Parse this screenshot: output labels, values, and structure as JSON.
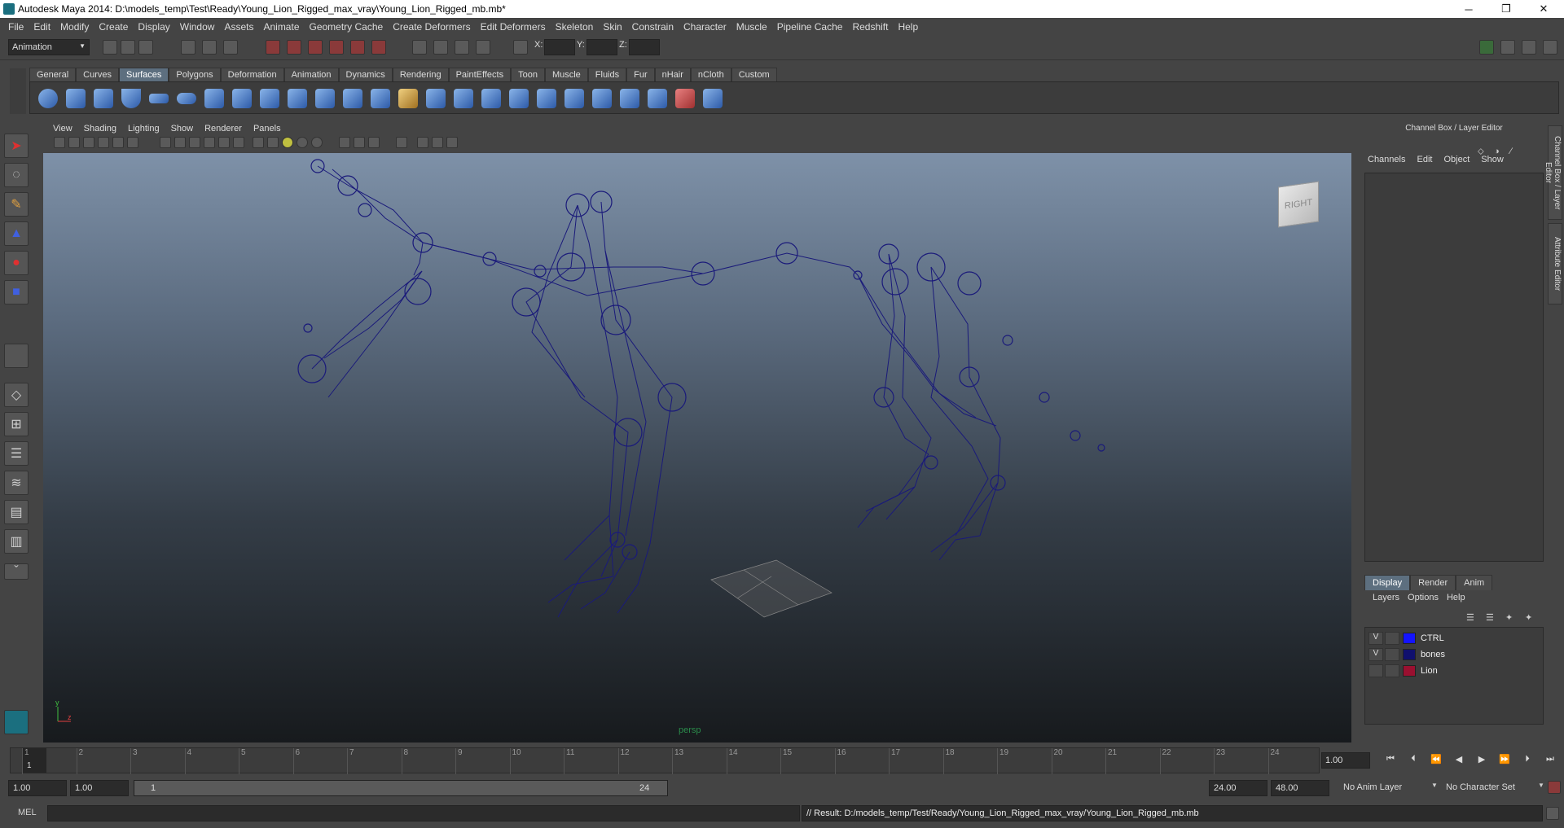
{
  "title": "Autodesk Maya 2014: D:\\models_temp\\Test\\Ready\\Young_Lion_Rigged_max_vray\\Young_Lion_Rigged_mb.mb*",
  "menus": [
    "File",
    "Edit",
    "Modify",
    "Create",
    "Display",
    "Window",
    "Assets",
    "Animate",
    "Geometry Cache",
    "Create Deformers",
    "Edit Deformers",
    "Skeleton",
    "Skin",
    "Constrain",
    "Character",
    "Muscle",
    "Pipeline Cache",
    "Redshift",
    "Help"
  ],
  "mode": "Animation",
  "xyz": {
    "x": "X:",
    "y": "Y:",
    "z": "Z:"
  },
  "shelf_tabs": [
    "General",
    "Curves",
    "Surfaces",
    "Polygons",
    "Deformation",
    "Animation",
    "Dynamics",
    "Rendering",
    "PaintEffects",
    "Toon",
    "Muscle",
    "Fluids",
    "Fur",
    "nHair",
    "nCloth",
    "Custom"
  ],
  "active_shelf": "Surfaces",
  "panel_menus": [
    "View",
    "Shading",
    "Lighting",
    "Show",
    "Renderer",
    "Panels"
  ],
  "viewcube_label": "RIGHT",
  "camera": "persp",
  "channel_box": {
    "title": "Channel Box / Layer Editor",
    "menus": [
      "Channels",
      "Edit",
      "Object",
      "Show"
    ]
  },
  "layer_tabs": [
    "Display",
    "Render",
    "Anim"
  ],
  "layer_menus": [
    "Layers",
    "Options",
    "Help"
  ],
  "layers": [
    {
      "vis": "V",
      "name": "CTRL",
      "color": "#1414ff"
    },
    {
      "vis": "V",
      "name": "bones",
      "color": "#10106e"
    },
    {
      "vis": "",
      "name": "Lion",
      "color": "#9a1030"
    }
  ],
  "side_tabs": [
    "Channel Box / Layer Editor",
    "Attribute Editor"
  ],
  "ticks": [
    "1",
    "2",
    "3",
    "4",
    "5",
    "6",
    "7",
    "8",
    "9",
    "10",
    "11",
    "12",
    "13",
    "14",
    "15",
    "16",
    "17",
    "18",
    "19",
    "20",
    "21",
    "22",
    "23",
    "24"
  ],
  "current_frame": "1.00",
  "range": {
    "start": "1.00",
    "anim_start": "1.00",
    "slider_start": "1",
    "slider_end": "24",
    "anim_end": "24.00",
    "end": "48.00"
  },
  "anim_layer": "No Anim Layer",
  "char_set": "No Character Set",
  "cmd": {
    "label": "MEL",
    "result": "// Result: D:/models_temp/Test/Ready/Young_Lion_Rigged_max_vray/Young_Lion_Rigged_mb.mb"
  },
  "colors": {
    "bone": "#1a1a7a",
    "accent": "#5d6f7f"
  }
}
